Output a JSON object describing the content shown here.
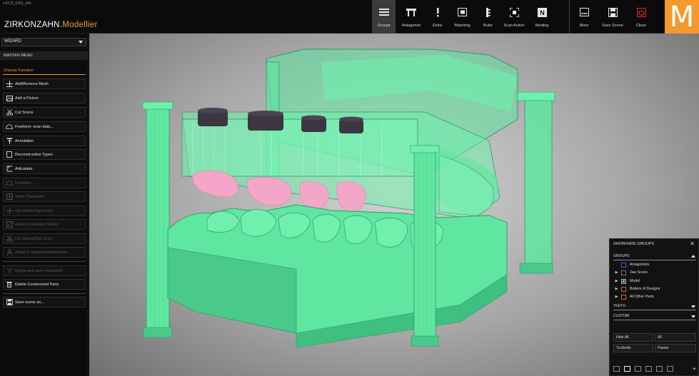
{
  "app": {
    "version": "v.6172_6151_x64",
    "brand_main": "ZIRKONZAHN.",
    "brand_sub": "Modellier",
    "logo_letter": "M",
    "accent_color": "#f39a2e"
  },
  "toolbar": {
    "tools": [
      {
        "label": "Groups",
        "icon": "groups-icon",
        "active": true
      },
      {
        "label": "Antagonist",
        "icon": "antagonist-icon"
      },
      {
        "label": "Extra",
        "icon": "exclamation-icon"
      },
      {
        "label": "Matching",
        "icon": "matching-icon"
      },
      {
        "label": "Ruler",
        "icon": "ruler-icon"
      },
      {
        "label": "Scan Action",
        "icon": "scan-action-icon"
      },
      {
        "label": "Nesting",
        "icon": "nesting-icon"
      }
    ],
    "actions": [
      {
        "label": "More",
        "icon": "more-icon"
      },
      {
        "label": "Save Scene",
        "icon": "save-icon"
      },
      {
        "label": "Close",
        "icon": "power-icon"
      }
    ]
  },
  "sidebar": {
    "wizard_label": "WIZARD",
    "master_menu": "MASTER MENU",
    "choose_function": "Choose Function",
    "items": [
      {
        "label": "Add/Remove Mesh",
        "icon": "add-mesh-icon",
        "enabled": true
      },
      {
        "label": "Add a Picture",
        "icon": "picture-icon",
        "enabled": true
      },
      {
        "label": "Cut Scans",
        "icon": "scissors-icon",
        "enabled": true
      },
      {
        "label": "Freeform: scan data...",
        "icon": "freeform-icon",
        "enabled": true
      },
      {
        "label": "Annotation",
        "icon": "annotation-icon",
        "enabled": true
      },
      {
        "label": "Reconstruction Types",
        "icon": "reconstruction-icon",
        "enabled": true
      },
      {
        "label": "Articulator",
        "icon": "articulator-icon",
        "enabled": true
      },
      {
        "label": "Freeform...",
        "icon": "freeform-icon",
        "enabled": false
      },
      {
        "label": "Teeth Placement",
        "icon": "teeth-icon",
        "enabled": false
      },
      {
        "label": "Situ Model Placement",
        "icon": "move-icon",
        "enabled": false
      },
      {
        "label": "Adapt to Situation Model",
        "icon": "adapt-icon",
        "enabled": false
      },
      {
        "label": "Cut Waxup/Situ Scan",
        "icon": "scissors-icon",
        "enabled": false
      },
      {
        "label": "Adapt to antagonist/adjacents...",
        "icon": "adapt-antagonist-icon",
        "enabled": false
      },
      {
        "label": "Merge and save restoration",
        "icon": "merge-icon",
        "enabled": false
      },
      {
        "label": "Delete Constructed Parts",
        "icon": "trash-icon",
        "enabled": true
      },
      {
        "label": "Save scene as...",
        "icon": "save-icon",
        "enabled": true
      }
    ]
  },
  "groups_panel": {
    "title": "SHOW/HIDE GROUPS",
    "groups_header": "GROUPS",
    "items": [
      {
        "label": "Antagonists",
        "expand": false,
        "color": "blue",
        "checked": false
      },
      {
        "label": "Jaw Scans",
        "expand": true,
        "color": "gray",
        "checked": false
      },
      {
        "label": "Model",
        "expand": true,
        "color": "green",
        "checked": true
      },
      {
        "label": "Bottom of Designs",
        "expand": true,
        "color": "orange",
        "checked": false
      },
      {
        "label": "All Other Parts",
        "expand": true,
        "color": "orange",
        "checked": false
      }
    ],
    "teeth_header": "TEETH",
    "custom_header": "CUSTOM",
    "buttons": [
      {
        "label": "Hide All"
      },
      {
        "label": "All"
      },
      {
        "label": "TruSmile"
      },
      {
        "label": "Plaster"
      }
    ]
  },
  "model_colors": {
    "plaster": "#5fe6a0",
    "plaster_dark": "#2f9a68",
    "gingiva": "#f3a6c8",
    "abutment": "#3b3640"
  }
}
